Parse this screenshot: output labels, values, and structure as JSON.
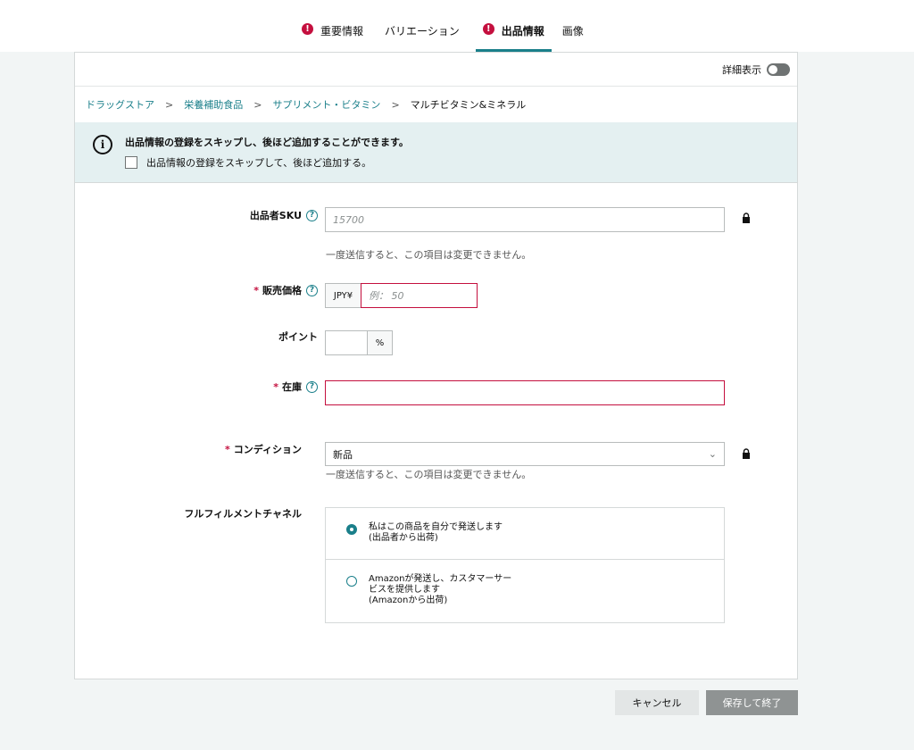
{
  "tabs": [
    {
      "label": "重要情報",
      "error": true,
      "active": false
    },
    {
      "label": "バリエーション",
      "error": false,
      "active": false
    },
    {
      "label": "出品情報",
      "error": true,
      "active": true
    },
    {
      "label": "画像",
      "error": false,
      "active": false
    }
  ],
  "detail_toggle_label": "詳細表示",
  "breadcrumb": {
    "items": [
      "ドラッグストア",
      "栄養補助食品",
      "サプリメント・ビタミン"
    ],
    "current": "マルチビタミン&ミネラル"
  },
  "info": {
    "title": "出品情報の登録をスキップし、後ほど追加することができます。",
    "checkbox_label": "出品情報の登録をスキップして、後ほど追加する。"
  },
  "fields": {
    "sku": {
      "label": "出品者SKU",
      "placeholder": "15700",
      "hint": "一度送信すると、この項目は変更できません。"
    },
    "price": {
      "required_mark": "*",
      "label": "販売価格",
      "currency": "JPY¥",
      "placeholder": "例： 50"
    },
    "points": {
      "label": "ポイント",
      "unit": "%"
    },
    "stock": {
      "required_mark": "*",
      "label": "在庫",
      "value": ""
    },
    "condition": {
      "required_mark": "*",
      "label": "コンディション",
      "value": "新品",
      "hint": "一度送信すると、この項目は変更できません。"
    },
    "fulfillment": {
      "label": "フルフィルメントチャネル",
      "options": [
        {
          "line1": "私はこの商品を自分で発送します",
          "line2": "(出品者から出荷)",
          "line3": "",
          "selected": true
        },
        {
          "line1": "Amazonが発送し、カスタマーサー",
          "line2": "ビスを提供します",
          "line3": "(Amazonから出荷)",
          "selected": false
        }
      ]
    }
  },
  "buttons": {
    "cancel": "キャンセル",
    "save": "保存して終了"
  },
  "icons": {
    "error": "exclamation-icon",
    "info": "info-icon",
    "help": "question-icon",
    "lock": "lock-icon",
    "chevron": "chevron-down-icon"
  },
  "colors": {
    "accent": "#1a7f8a",
    "error": "#c40f3e",
    "info_bg": "#e4f0f1"
  }
}
